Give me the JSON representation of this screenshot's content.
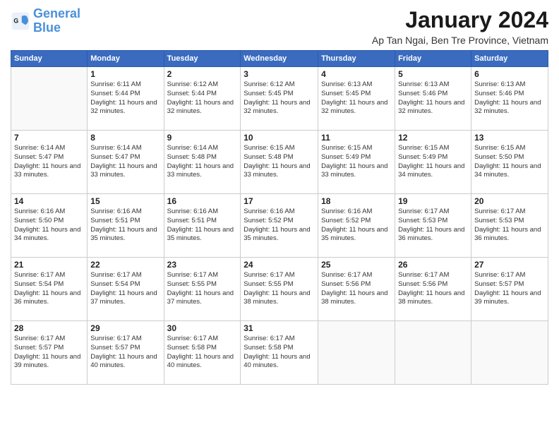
{
  "logo": {
    "text_general": "General",
    "text_blue": "Blue"
  },
  "title": "January 2024",
  "location": "Ap Tan Ngai, Ben Tre Province, Vietnam",
  "days_header": [
    "Sunday",
    "Monday",
    "Tuesday",
    "Wednesday",
    "Thursday",
    "Friday",
    "Saturday"
  ],
  "weeks": [
    [
      {
        "day": "",
        "sunrise": "",
        "sunset": "",
        "daylight": ""
      },
      {
        "day": "1",
        "sunrise": "Sunrise: 6:11 AM",
        "sunset": "Sunset: 5:44 PM",
        "daylight": "Daylight: 11 hours and 32 minutes."
      },
      {
        "day": "2",
        "sunrise": "Sunrise: 6:12 AM",
        "sunset": "Sunset: 5:44 PM",
        "daylight": "Daylight: 11 hours and 32 minutes."
      },
      {
        "day": "3",
        "sunrise": "Sunrise: 6:12 AM",
        "sunset": "Sunset: 5:45 PM",
        "daylight": "Daylight: 11 hours and 32 minutes."
      },
      {
        "day": "4",
        "sunrise": "Sunrise: 6:13 AM",
        "sunset": "Sunset: 5:45 PM",
        "daylight": "Daylight: 11 hours and 32 minutes."
      },
      {
        "day": "5",
        "sunrise": "Sunrise: 6:13 AM",
        "sunset": "Sunset: 5:46 PM",
        "daylight": "Daylight: 11 hours and 32 minutes."
      },
      {
        "day": "6",
        "sunrise": "Sunrise: 6:13 AM",
        "sunset": "Sunset: 5:46 PM",
        "daylight": "Daylight: 11 hours and 32 minutes."
      }
    ],
    [
      {
        "day": "7",
        "sunrise": "Sunrise: 6:14 AM",
        "sunset": "Sunset: 5:47 PM",
        "daylight": "Daylight: 11 hours and 33 minutes."
      },
      {
        "day": "8",
        "sunrise": "Sunrise: 6:14 AM",
        "sunset": "Sunset: 5:47 PM",
        "daylight": "Daylight: 11 hours and 33 minutes."
      },
      {
        "day": "9",
        "sunrise": "Sunrise: 6:14 AM",
        "sunset": "Sunset: 5:48 PM",
        "daylight": "Daylight: 11 hours and 33 minutes."
      },
      {
        "day": "10",
        "sunrise": "Sunrise: 6:15 AM",
        "sunset": "Sunset: 5:48 PM",
        "daylight": "Daylight: 11 hours and 33 minutes."
      },
      {
        "day": "11",
        "sunrise": "Sunrise: 6:15 AM",
        "sunset": "Sunset: 5:49 PM",
        "daylight": "Daylight: 11 hours and 33 minutes."
      },
      {
        "day": "12",
        "sunrise": "Sunrise: 6:15 AM",
        "sunset": "Sunset: 5:49 PM",
        "daylight": "Daylight: 11 hours and 34 minutes."
      },
      {
        "day": "13",
        "sunrise": "Sunrise: 6:15 AM",
        "sunset": "Sunset: 5:50 PM",
        "daylight": "Daylight: 11 hours and 34 minutes."
      }
    ],
    [
      {
        "day": "14",
        "sunrise": "Sunrise: 6:16 AM",
        "sunset": "Sunset: 5:50 PM",
        "daylight": "Daylight: 11 hours and 34 minutes."
      },
      {
        "day": "15",
        "sunrise": "Sunrise: 6:16 AM",
        "sunset": "Sunset: 5:51 PM",
        "daylight": "Daylight: 11 hours and 35 minutes."
      },
      {
        "day": "16",
        "sunrise": "Sunrise: 6:16 AM",
        "sunset": "Sunset: 5:51 PM",
        "daylight": "Daylight: 11 hours and 35 minutes."
      },
      {
        "day": "17",
        "sunrise": "Sunrise: 6:16 AM",
        "sunset": "Sunset: 5:52 PM",
        "daylight": "Daylight: 11 hours and 35 minutes."
      },
      {
        "day": "18",
        "sunrise": "Sunrise: 6:16 AM",
        "sunset": "Sunset: 5:52 PM",
        "daylight": "Daylight: 11 hours and 35 minutes."
      },
      {
        "day": "19",
        "sunrise": "Sunrise: 6:17 AM",
        "sunset": "Sunset: 5:53 PM",
        "daylight": "Daylight: 11 hours and 36 minutes."
      },
      {
        "day": "20",
        "sunrise": "Sunrise: 6:17 AM",
        "sunset": "Sunset: 5:53 PM",
        "daylight": "Daylight: 11 hours and 36 minutes."
      }
    ],
    [
      {
        "day": "21",
        "sunrise": "Sunrise: 6:17 AM",
        "sunset": "Sunset: 5:54 PM",
        "daylight": "Daylight: 11 hours and 36 minutes."
      },
      {
        "day": "22",
        "sunrise": "Sunrise: 6:17 AM",
        "sunset": "Sunset: 5:54 PM",
        "daylight": "Daylight: 11 hours and 37 minutes."
      },
      {
        "day": "23",
        "sunrise": "Sunrise: 6:17 AM",
        "sunset": "Sunset: 5:55 PM",
        "daylight": "Daylight: 11 hours and 37 minutes."
      },
      {
        "day": "24",
        "sunrise": "Sunrise: 6:17 AM",
        "sunset": "Sunset: 5:55 PM",
        "daylight": "Daylight: 11 hours and 38 minutes."
      },
      {
        "day": "25",
        "sunrise": "Sunrise: 6:17 AM",
        "sunset": "Sunset: 5:56 PM",
        "daylight": "Daylight: 11 hours and 38 minutes."
      },
      {
        "day": "26",
        "sunrise": "Sunrise: 6:17 AM",
        "sunset": "Sunset: 5:56 PM",
        "daylight": "Daylight: 11 hours and 38 minutes."
      },
      {
        "day": "27",
        "sunrise": "Sunrise: 6:17 AM",
        "sunset": "Sunset: 5:57 PM",
        "daylight": "Daylight: 11 hours and 39 minutes."
      }
    ],
    [
      {
        "day": "28",
        "sunrise": "Sunrise: 6:17 AM",
        "sunset": "Sunset: 5:57 PM",
        "daylight": "Daylight: 11 hours and 39 minutes."
      },
      {
        "day": "29",
        "sunrise": "Sunrise: 6:17 AM",
        "sunset": "Sunset: 5:57 PM",
        "daylight": "Daylight: 11 hours and 40 minutes."
      },
      {
        "day": "30",
        "sunrise": "Sunrise: 6:17 AM",
        "sunset": "Sunset: 5:58 PM",
        "daylight": "Daylight: 11 hours and 40 minutes."
      },
      {
        "day": "31",
        "sunrise": "Sunrise: 6:17 AM",
        "sunset": "Sunset: 5:58 PM",
        "daylight": "Daylight: 11 hours and 40 minutes."
      },
      {
        "day": "",
        "sunrise": "",
        "sunset": "",
        "daylight": ""
      },
      {
        "day": "",
        "sunrise": "",
        "sunset": "",
        "daylight": ""
      },
      {
        "day": "",
        "sunrise": "",
        "sunset": "",
        "daylight": ""
      }
    ]
  ]
}
